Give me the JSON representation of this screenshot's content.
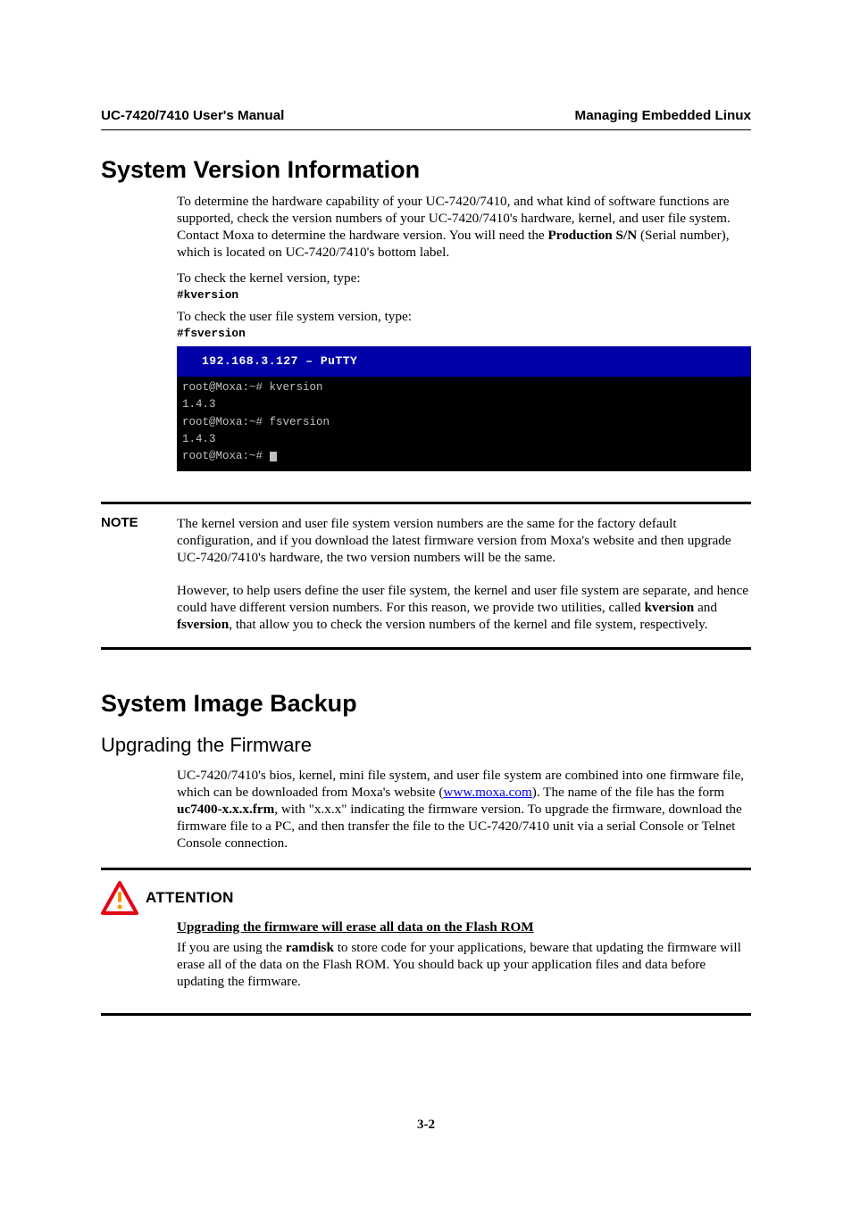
{
  "header": {
    "left": "UC-7420/7410 User's Manual",
    "right": "Managing Embedded Linux"
  },
  "section1": {
    "heading": "System Version Information",
    "para1_a": "To determine the hardware capability of your UC-7420/7410, and what kind of software functions are supported, check the version numbers of your UC-7420/7410's hardware, kernel, and user file system. Contact Moxa to determine the hardware version. You will need the ",
    "para1_bold": "Production S/N",
    "para1_b": " (Serial number), which is located on UC-7420/7410's bottom label.",
    "para2": "To check the kernel version, type:",
    "cmd2": "#kversion",
    "para3": "To check the user file system version, type:",
    "cmd3": "#fsversion",
    "terminal": {
      "title": "192.168.3.127 – PuTTY",
      "lines": [
        "root@Moxa:~# kversion",
        "1.4.3",
        "root@Moxa:~# fsversion",
        "1.4.3"
      ],
      "prompt": "root@Moxa:~# "
    }
  },
  "note": {
    "label": "NOTE",
    "p1": "The kernel version and user file system version numbers are the same for the factory default configuration, and if you download the latest firmware version from Moxa's website and then upgrade UC-7420/7410's hardware, the two version numbers will be the same.",
    "p2_a": "However, to help users define the user file system, the kernel and user file system are separate, and hence could have different version numbers. For this reason, we provide two utilities, called ",
    "p2_b1": "kversion",
    "p2_mid": " and ",
    "p2_b2": "fsversion",
    "p2_c": ", that allow you to check the version numbers of the kernel and file system, respectively."
  },
  "section2": {
    "heading": "System Image Backup",
    "subheading": "Upgrading the Firmware",
    "p1_a": "UC-7420/7410's bios, kernel, mini file system, and user file system are combined into one firmware file, which can be downloaded from Moxa's website (",
    "p1_link": "www.moxa.com",
    "p1_b": "). The name of the file has the form ",
    "p1_bold": "uc7400-x.x.x.frm",
    "p1_c": ", with \"x.x.x\" indicating the firmware version. To upgrade the firmware, download the firmware file to a PC, and then transfer the file to the UC-7420/7410 unit via a serial Console or Telnet Console connection."
  },
  "attention": {
    "label": "ATTENTION",
    "subtitle": "Upgrading the firmware will erase all data on the Flash ROM",
    "body_a": "If you are using the ",
    "body_bold": "ramdisk",
    "body_b": " to store code for your applications, beware that updating the firmware will erase all of the data on the Flash ROM. You should back up your application files and data before updating the firmware."
  },
  "page_number": "3-2"
}
